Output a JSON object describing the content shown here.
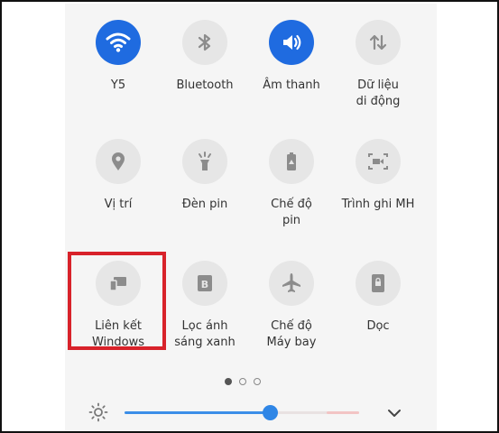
{
  "quick_settings": {
    "tiles": [
      {
        "label": "Y5",
        "icon": "wifi-icon",
        "active": true
      },
      {
        "label": "Bluetooth",
        "icon": "bluetooth-icon",
        "active": false
      },
      {
        "label": "Âm thanh",
        "icon": "sound-icon",
        "active": true
      },
      {
        "label": "Dữ liệu\ndi động",
        "icon": "mobile-data-icon",
        "active": false
      },
      {
        "label": "Vị trí",
        "icon": "location-icon",
        "active": false
      },
      {
        "label": "Đèn pin",
        "icon": "flashlight-icon",
        "active": false
      },
      {
        "label": "Chế độ\npin",
        "icon": "battery-saver-icon",
        "active": false
      },
      {
        "label": "Trình ghi MH",
        "icon": "screen-recorder-icon",
        "active": false
      },
      {
        "label": "Liên kết\nWindows",
        "icon": "link-to-windows-icon",
        "active": false
      },
      {
        "label": "Lọc ánh\nsáng xanh",
        "icon": "blue-light-filter-icon",
        "active": false
      },
      {
        "label": "Chế độ\nMáy bay",
        "icon": "airplane-icon",
        "active": false
      },
      {
        "label": "Dọc",
        "icon": "portrait-lock-icon",
        "active": false
      }
    ],
    "page_indicator": {
      "count": 3,
      "current": 1
    },
    "brightness": {
      "level": 0.62,
      "icon": "sun-icon",
      "expand_icon": "chevron-down-icon"
    },
    "highlight_color": "#d8222a",
    "accent_color": "#1f6be0"
  }
}
